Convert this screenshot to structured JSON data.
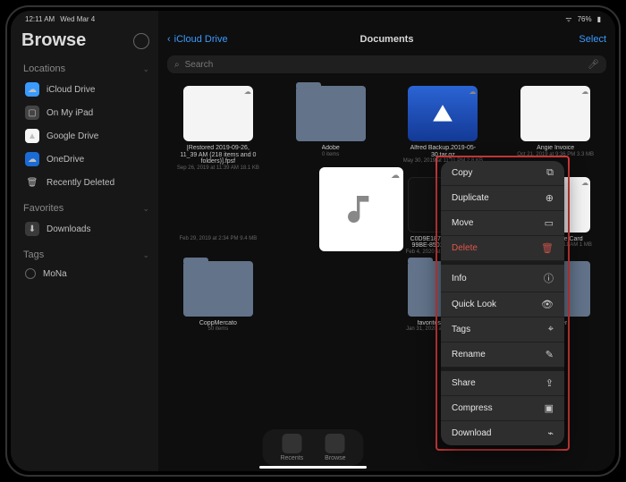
{
  "status": {
    "time": "12:11 AM",
    "date": "Wed Mar 4",
    "battery": "76%"
  },
  "sidebar": {
    "title": "Browse",
    "sections": {
      "locations": "Locations",
      "favorites": "Favorites",
      "tags": "Tags"
    },
    "locations": [
      {
        "label": "iCloud Drive"
      },
      {
        "label": "On My iPad"
      },
      {
        "label": "Google Drive"
      },
      {
        "label": "OneDrive"
      },
      {
        "label": "Recently Deleted"
      }
    ],
    "favorites": [
      {
        "label": "Downloads"
      }
    ],
    "tags": [
      {
        "label": "MoNa"
      }
    ]
  },
  "header": {
    "back": "iCloud Drive",
    "title": "Documents",
    "select": "Select"
  },
  "search": {
    "placeholder": "Search"
  },
  "files": [
    {
      "name": "[Restored 2019-09-26, 11_39 AM (218 items and 0 folders)].fpsf",
      "meta": "Sep 26, 2019 at 11:39 AM\n18.1 KB"
    },
    {
      "name": "Adobe",
      "meta": "0 items"
    },
    {
      "name": "Alfred Backup.2019-05-30.tar.gz",
      "meta": "May 30, 2019 at 11:11 PM\n2.8 KB"
    },
    {
      "name": "Angie Invoice",
      "meta": "Oct 21, 2019 at 9:36 PM\n3.3 MB"
    },
    {
      "name": "",
      "meta": "Feb 29, 2019 at 2:34 PM\n9.4 MB"
    },
    {
      "name": "",
      "meta": ""
    },
    {
      "name": "C0D9E187-2F46-4FA2-99BE-85012A289DCF",
      "meta": "Feb 4, 2020 at 8:24 PM\n2.5 MB"
    },
    {
      "name": "Car Insurance Card",
      "meta": "Jul 16, 2019 at 10:11 AM\n1 MB"
    },
    {
      "name": "CoppMercato",
      "meta": "50 items"
    },
    {
      "name": "",
      "meta": ""
    },
    {
      "name": "favorites_1_31_20",
      "meta": "Jan 31, 2020 at 11:22 AM\n0 KB"
    },
    {
      "name": "iA Writer",
      "meta": "3 items"
    }
  ],
  "context_menu": {
    "items": [
      {
        "label": "Copy",
        "icon": "⧉",
        "danger": false
      },
      {
        "label": "Duplicate",
        "icon": "⊕",
        "danger": false
      },
      {
        "label": "Move",
        "icon": "▭",
        "danger": false
      },
      {
        "label": "Delete",
        "icon": "🗑",
        "danger": true
      },
      {
        "gap": true
      },
      {
        "label": "Info",
        "icon": "ⓘ",
        "danger": false
      },
      {
        "label": "Quick Look",
        "icon": "👁",
        "danger": false
      },
      {
        "label": "Tags",
        "icon": "⌖",
        "danger": false
      },
      {
        "label": "Rename",
        "icon": "✎",
        "danger": false
      },
      {
        "gap": true
      },
      {
        "label": "Share",
        "icon": "⇪",
        "danger": false
      },
      {
        "label": "Compress",
        "icon": "▣",
        "danger": false
      },
      {
        "label": "Download",
        "icon": "⌁",
        "danger": false
      }
    ]
  },
  "dock": {
    "recents": "Recents",
    "browse": "Browse"
  }
}
